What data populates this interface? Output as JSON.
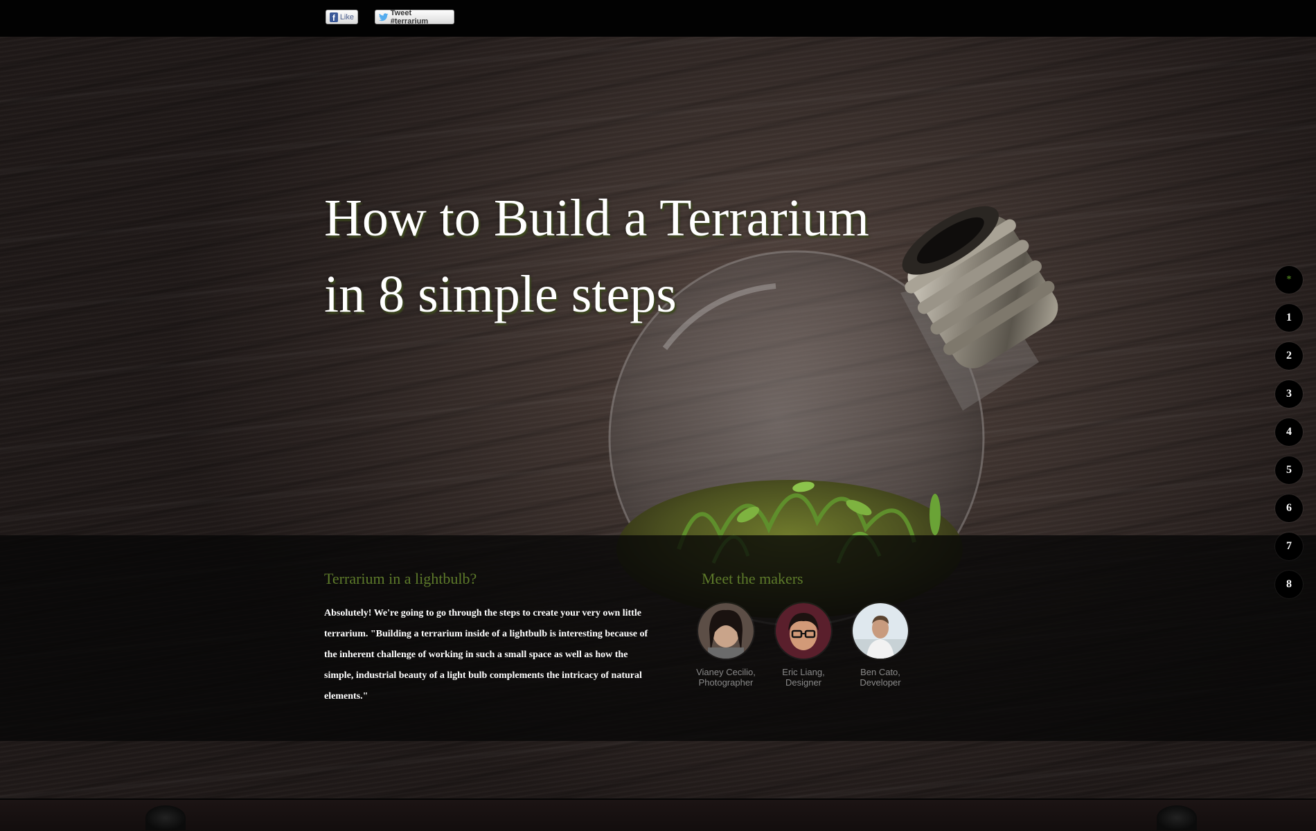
{
  "social": {
    "like_label": "Like",
    "fb_glyph": "f",
    "tweet_label": "Tweet #terrarium"
  },
  "hero": {
    "title_line1": "How to Build a Terrarium",
    "title_line2": "in 8 simple steps"
  },
  "about": {
    "heading": "Terrarium in a lightbulb?",
    "body": "Absolutely! We're going to go through the steps to create your very own little terrarium. \"Building a terrarium inside of a lightbulb is interesting because of the inherent challenge of working in such a small space as well as how the simple, industrial beauty of a light bulb complements the intricacy of natural elements.\""
  },
  "makers": {
    "heading": "Meet the makers",
    "people": [
      {
        "name_line": "Vianey Cecilio,",
        "role_line": "Photographer"
      },
      {
        "name_line": "Eric Liang,",
        "role_line": "Designer"
      },
      {
        "name_line": "Ben Cato,",
        "role_line": "Developer"
      }
    ]
  },
  "steps": {
    "items": [
      "*",
      "1",
      "2",
      "3",
      "4",
      "5",
      "6",
      "7",
      "8"
    ],
    "active_index": 0
  },
  "colors": {
    "accent_green": "#5d7a2a",
    "title_shadow": "#3d4a1e",
    "facebook_blue": "#3b5998",
    "twitter_blue": "#55acee"
  },
  "icons": [
    "facebook-icon",
    "twitter-bird-icon"
  ]
}
